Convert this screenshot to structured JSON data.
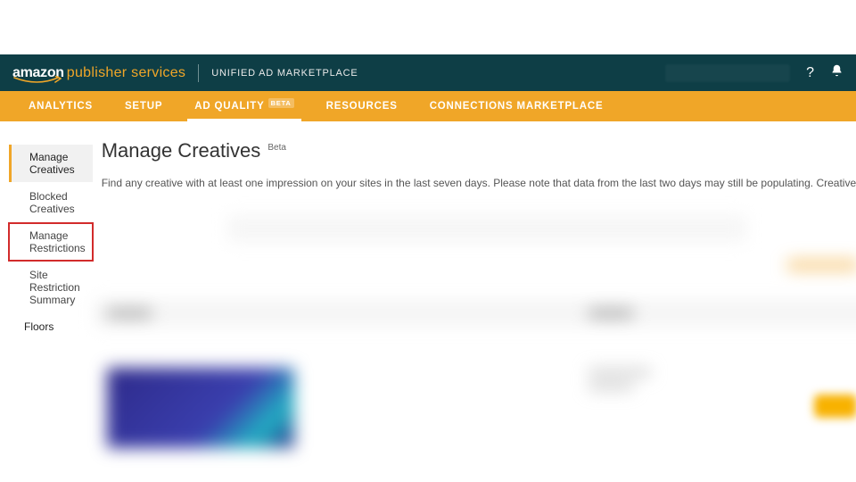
{
  "brand": {
    "amazon": "amazon",
    "rest": "publisher services"
  },
  "header": {
    "app_title": "UNIFIED AD MARKETPLACE",
    "help_icon": "?",
    "bell_icon": "bell"
  },
  "nav": {
    "items": [
      {
        "label": "ANALYTICS",
        "active": false
      },
      {
        "label": "SETUP",
        "active": false
      },
      {
        "label": "AD QUALITY",
        "badge": "BETA",
        "active": true
      },
      {
        "label": "RESOURCES",
        "active": false
      },
      {
        "label": "CONNECTIONS MARKETPLACE",
        "active": false
      }
    ]
  },
  "sidebar": {
    "items": [
      {
        "label": "Manage Creatives",
        "active": true,
        "indent": true
      },
      {
        "label": "Blocked Creatives",
        "indent": true
      },
      {
        "label": "Manage Restrictions",
        "indent": true,
        "highlight": true
      },
      {
        "label": "Site Restriction Summary",
        "indent": true
      },
      {
        "label": "Floors",
        "root": true
      }
    ]
  },
  "page": {
    "title": "Manage Creatives",
    "title_badge": "Beta",
    "description": "Find any creative with at least one impression on your sites in the last seven days. Please note that data from the last two days may still be populating. Creatives fro"
  }
}
